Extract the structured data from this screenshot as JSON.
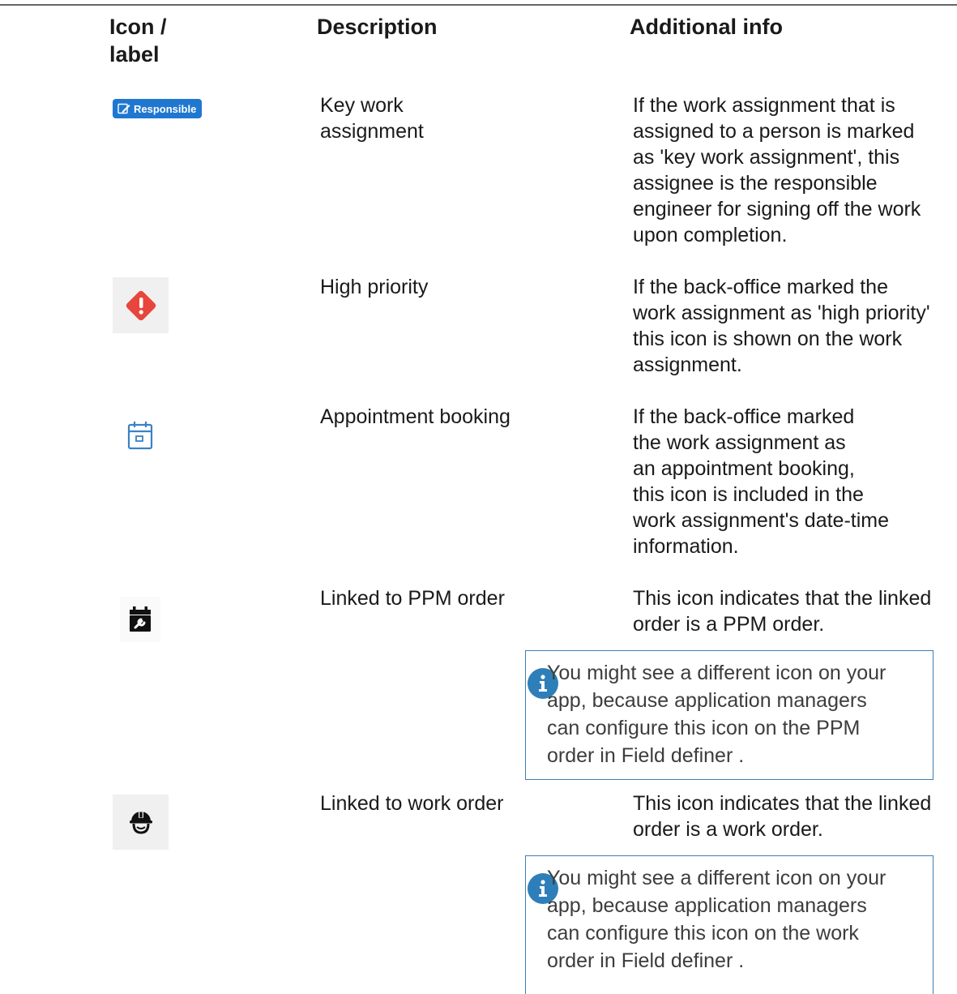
{
  "table": {
    "headers": {
      "icon_label": "Icon /\nlabel",
      "description": "Description",
      "additional_info": "Additional info"
    },
    "rows": [
      {
        "icon": "responsible-badge",
        "badge_text": "Responsible",
        "description": "Key work\nassignment",
        "info": "If the work assignment that is\nassigned to a person is marked\nas 'key work assignment', this\nassignee is the responsible\nengineer for signing off the work\nupon completion."
      },
      {
        "icon": "high-priority-icon",
        "description": "High priority",
        "info": "If the back-office marked the\nwork assignment as 'high priority'\nthis icon is shown on the work\nassignment."
      },
      {
        "icon": "calendar-icon",
        "description": "Appointment booking",
        "info": "If the back-office marked\nthe work assignment as\nan appointment booking,\nthis icon is included in the\nwork assignment's date-time\ninformation."
      },
      {
        "icon": "ppm-calendar-wrench-icon",
        "description": "Linked to PPM order",
        "info": "This icon indicates that the linked\norder is a PPM order.",
        "note": "You might see a different icon on your\napp, because application managers\ncan configure this icon on the PPM\norder in Field definer ."
      },
      {
        "icon": "hard-hat-worker-icon",
        "description": "Linked to work order",
        "info": "This icon indicates that the linked\norder is a work order.",
        "note": "You might see a different icon on your\napp, because application managers\ncan configure this icon on the work\norder in Field definer ."
      }
    ]
  },
  "colors": {
    "badge_blue": "#1f77d0",
    "priority_red": "#e8453c",
    "calendar_blue": "#3b82c4",
    "note_border": "#3d7fb8",
    "note_icon": "#2e7fb9"
  }
}
